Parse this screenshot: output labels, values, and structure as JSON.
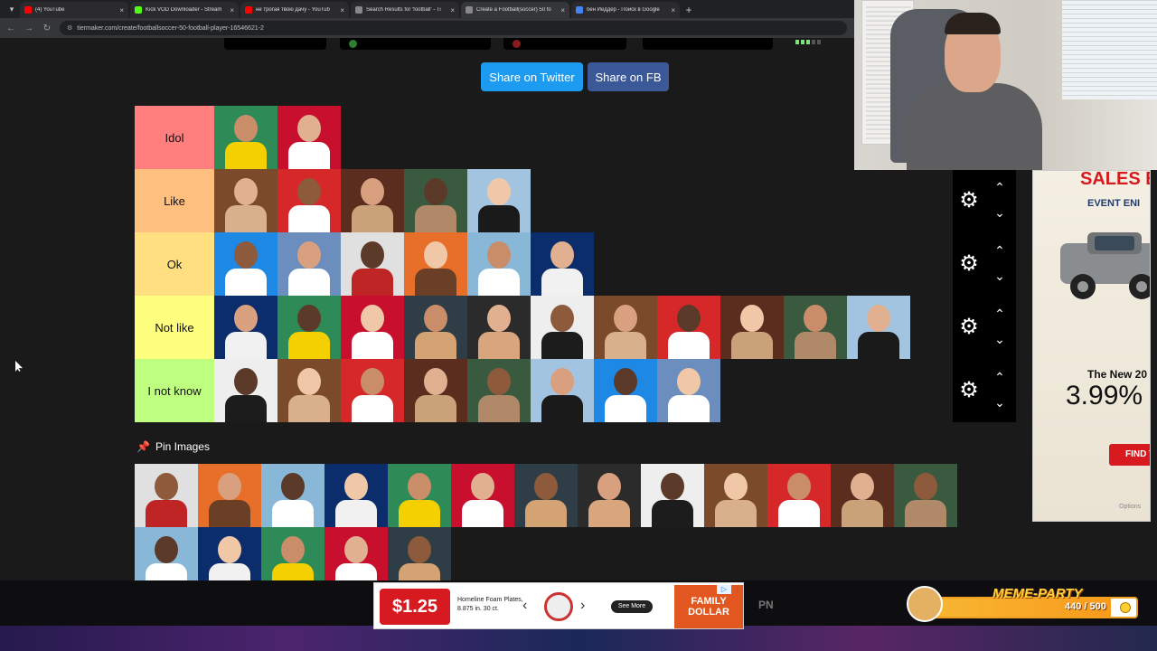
{
  "browser": {
    "tabs": [
      {
        "title": "(4) YouTube",
        "favicon_color": "#ff0000",
        "active": false
      },
      {
        "title": "Kick VOD Downloader - Stream",
        "favicon_color": "#53fc18",
        "active": false
      },
      {
        "title": "не трогая твою дачу - YouTub",
        "favicon_color": "#ff0000",
        "active": false
      },
      {
        "title": "Search Results for 'football' - Ti",
        "favicon_color": "#888888",
        "active": false
      },
      {
        "title": "Create a Football(soccer) 50 fo",
        "favicon_color": "#888888",
        "active": true
      },
      {
        "title": "бен Йеддер - Поиск в Google",
        "favicon_color": "#4285f4",
        "active": false
      }
    ],
    "url": "tiermaker.com/create/footballsoccer-50-football-player-16546621-2"
  },
  "share": {
    "twitter_label": "Share on Twitter",
    "fb_label": "Share on FB"
  },
  "tiers": [
    {
      "label": "Idol",
      "color": "#ff7f7f",
      "count": 2
    },
    {
      "label": "Like",
      "color": "#ffbf7f",
      "count": 5
    },
    {
      "label": "Ok",
      "color": "#ffdf7f",
      "count": 6
    },
    {
      "label": "Not like",
      "color": "#ffff7f",
      "count": 11
    },
    {
      "label": "I not know",
      "color": "#bfff7f",
      "count": 8
    }
  ],
  "pin_images": {
    "label": "Pin Images",
    "count": 18
  },
  "side_ad": {
    "headline": "SALES E",
    "subhead": "EVENT ENI",
    "model": "The New 20",
    "rate": "3.99%",
    "cta": "FIND Y",
    "fine": "Options"
  },
  "bottom_ad": {
    "price": "$1.25",
    "product": "Homeline Foam Plates, 8.875 in. 30 ct.",
    "see_more": "See More",
    "brand": "FAMILY DOLLAR"
  },
  "pn_label": "PN",
  "meme_party": {
    "title": "MEME-PARTY",
    "count": "440 / 500",
    "progress_fraction": 0.88
  }
}
